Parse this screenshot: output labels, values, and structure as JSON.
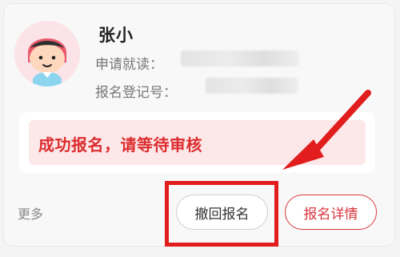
{
  "applicant": {
    "name": "张小",
    "apply_label": "申请就读：",
    "regno_label": "报名登记号："
  },
  "status": {
    "text": "成功报名，请等待审核"
  },
  "actions": {
    "more_label": "更多",
    "withdraw_label": "撤回报名",
    "details_label": "报名详情"
  },
  "colors": {
    "accent_red": "#dc2d2f",
    "status_bg": "#fde8e9",
    "annotation_red": "#e11d1d"
  },
  "icons": {
    "avatar": "child-avatar-icon",
    "annotation": "arrow-pointer-icon"
  }
}
